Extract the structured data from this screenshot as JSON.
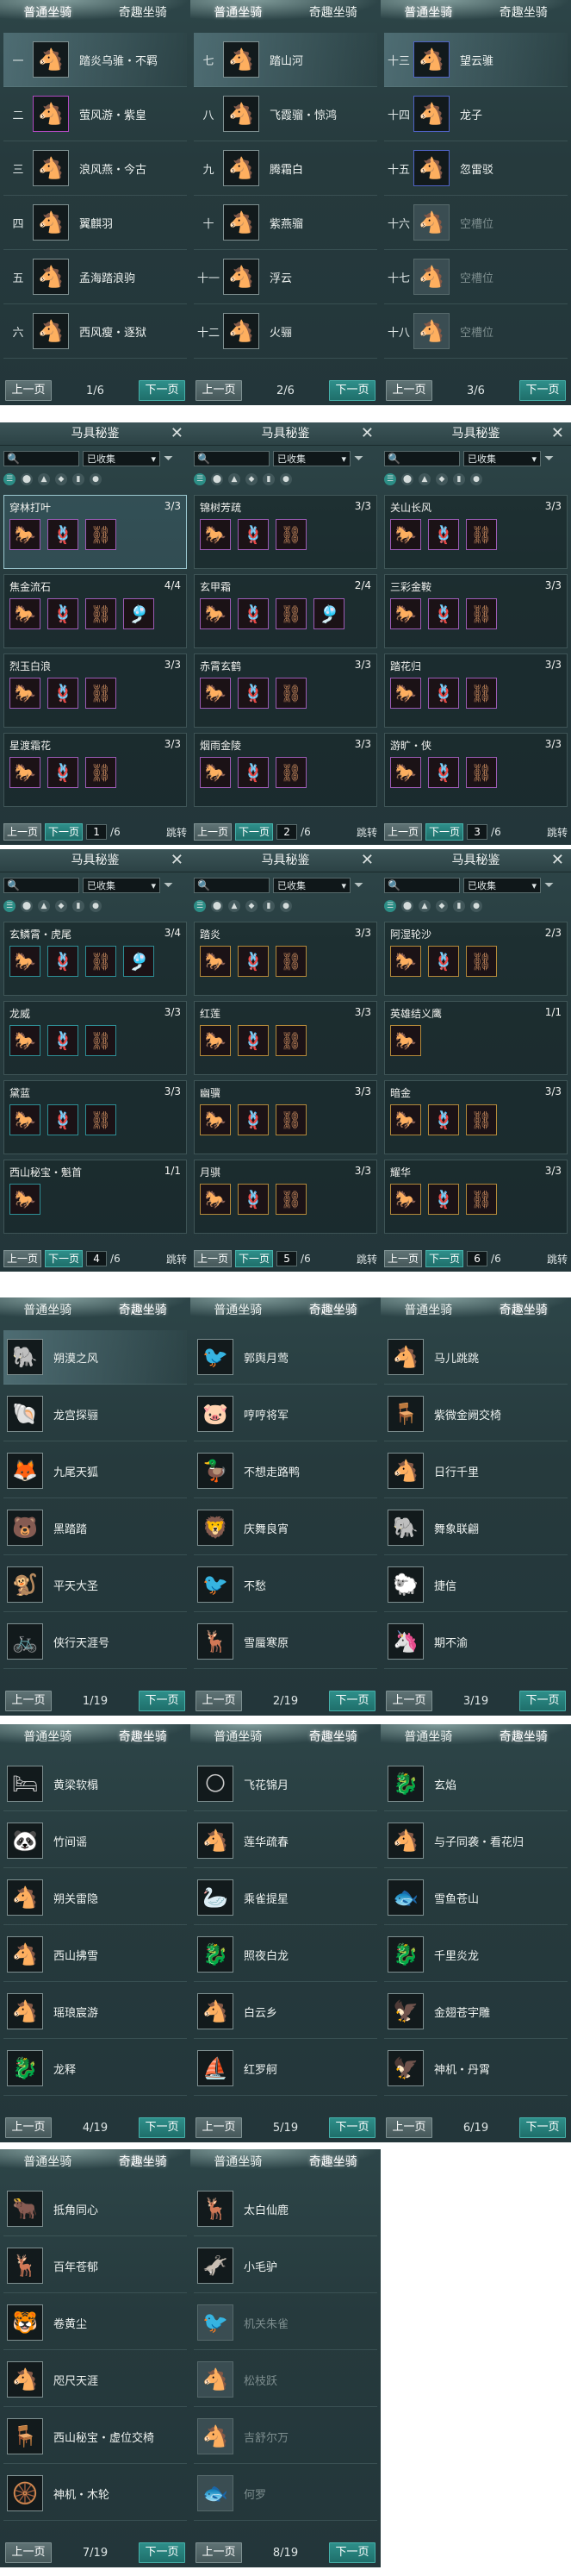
{
  "mount_tabs": {
    "normal": "普通坐骑",
    "fun": "奇趣坐骑"
  },
  "pager_labels": {
    "prev": "上一页",
    "next": "下一页"
  },
  "gear": {
    "title": "马具秘鉴",
    "close": "✕",
    "filter_value": "已收集",
    "jump": "跳转"
  },
  "mount_pages": [
    {
      "page": "1/6",
      "rows": [
        {
          "num": "一",
          "name": "踏炎乌骓・不羁",
          "icon": "🐴",
          "frame": "normal",
          "sel": true
        },
        {
          "num": "二",
          "name": "萤风游・紫皇",
          "icon": "🐴",
          "frame": "purple"
        },
        {
          "num": "三",
          "name": "浪风燕・今古",
          "icon": "🐴",
          "frame": "normal"
        },
        {
          "num": "四",
          "name": "翼麒羽",
          "icon": "🐴",
          "frame": "normal"
        },
        {
          "num": "五",
          "name": "孟海踏浪驹",
          "icon": "🐴",
          "frame": "normal"
        },
        {
          "num": "六",
          "name": "西风瘦・逐狱",
          "icon": "🐴",
          "frame": "normal"
        }
      ]
    },
    {
      "page": "2/6",
      "rows": [
        {
          "num": "七",
          "name": "踏山河",
          "icon": "🐴",
          "frame": "normal",
          "sel": true
        },
        {
          "num": "八",
          "name": "飞霞骝・惊鸿",
          "icon": "🐴",
          "frame": "normal"
        },
        {
          "num": "九",
          "name": "腾霜白",
          "icon": "🐴",
          "frame": "normal"
        },
        {
          "num": "十",
          "name": "紫燕骝",
          "icon": "🐴",
          "frame": "normal"
        },
        {
          "num": "十一",
          "name": "浮云",
          "icon": "🐴",
          "frame": "normal"
        },
        {
          "num": "十二",
          "name": "火骊",
          "icon": "🐴",
          "frame": "normal"
        }
      ]
    },
    {
      "page": "3/6",
      "rows": [
        {
          "num": "十三",
          "name": "望云骓",
          "icon": "🐴",
          "frame": "blue",
          "sel": true
        },
        {
          "num": "十四",
          "name": "龙子",
          "icon": "🐴",
          "frame": "blue"
        },
        {
          "num": "十五",
          "name": "忽雷驳",
          "icon": "🐴",
          "frame": "blue"
        },
        {
          "num": "十六",
          "name": "空槽位",
          "icon": "🐴",
          "frame": "empty"
        },
        {
          "num": "十七",
          "name": "空槽位",
          "icon": "🐴",
          "frame": "empty"
        },
        {
          "num": "十八",
          "name": "空槽位",
          "icon": "🐴",
          "frame": "empty"
        }
      ]
    }
  ],
  "gear_pages": [
    {
      "page": "1",
      "total": "/6",
      "sets": [
        {
          "name": "穿林打叶",
          "count": "3/3",
          "items": [
            "🐎",
            "🪢",
            "⛓"
          ],
          "sel": true
        },
        {
          "name": "焦金流石",
          "count": "4/4",
          "items": [
            "🐎",
            "🪢",
            "⛓",
            "🎐"
          ]
        },
        {
          "name": "烈玉白浪",
          "count": "3/3",
          "items": [
            "🐎",
            "🪢",
            "⛓"
          ]
        },
        {
          "name": "星渡霜花",
          "count": "3/3",
          "items": [
            "🐎",
            "🪢",
            "⛓"
          ]
        }
      ]
    },
    {
      "page": "2",
      "total": "/6",
      "sets": [
        {
          "name": "锦树芳疏",
          "count": "3/3",
          "items": [
            "🐎",
            "🪢",
            "⛓"
          ]
        },
        {
          "name": "玄甲霜",
          "count": "2/4",
          "items": [
            "🐎",
            "🪢",
            "⛓",
            "🎐"
          ]
        },
        {
          "name": "赤霄玄鹤",
          "count": "3/3",
          "items": [
            "🐎",
            "🪢",
            "⛓"
          ]
        },
        {
          "name": "烟雨金陵",
          "count": "3/3",
          "items": [
            "🐎",
            "🪢",
            "⛓"
          ]
        }
      ]
    },
    {
      "page": "3",
      "total": "/6",
      "sets": [
        {
          "name": "关山长风",
          "count": "3/3",
          "items": [
            "🐎",
            "🪢",
            "⛓"
          ]
        },
        {
          "name": "三彩金鞍",
          "count": "3/3",
          "items": [
            "🐎",
            "🪢",
            "⛓"
          ]
        },
        {
          "name": "踏花归",
          "count": "3/3",
          "items": [
            "🐎",
            "🪢",
            "⛓"
          ]
        },
        {
          "name": "游旷・侠",
          "count": "3/3",
          "items": [
            "🐎",
            "🪢",
            "⛓"
          ]
        }
      ]
    },
    {
      "page": "4",
      "total": "/6",
      "sets": [
        {
          "name": "玄鳞霄・虎尾",
          "count": "3/4",
          "items": [
            "🐎",
            "🪢",
            "⛓",
            "🎐"
          ]
        },
        {
          "name": "龙威",
          "count": "3/3",
          "items": [
            "🐎",
            "🪢",
            "⛓"
          ]
        },
        {
          "name": "黛蓝",
          "count": "3/3",
          "items": [
            "🐎",
            "🪢",
            "⛓"
          ]
        },
        {
          "name": "西山秘宝・魁首",
          "count": "1/1",
          "items": [
            "🐎"
          ]
        }
      ]
    },
    {
      "page": "5",
      "total": "/6",
      "sets": [
        {
          "name": "踏炎",
          "count": "3/3",
          "items": [
            "🐎",
            "🪢",
            "⛓"
          ]
        },
        {
          "name": "红莲",
          "count": "3/3",
          "items": [
            "🐎",
            "🪢",
            "⛓"
          ]
        },
        {
          "name": "幽骥",
          "count": "3/3",
          "items": [
            "🐎",
            "🪢",
            "⛓"
          ]
        },
        {
          "name": "月骐",
          "count": "3/3",
          "items": [
            "🐎",
            "🪢",
            "⛓"
          ]
        }
      ]
    },
    {
      "page": "6",
      "total": "/6",
      "sets": [
        {
          "name": "阿湿轮沙",
          "count": "2/3",
          "items": [
            "🐎",
            "🪢",
            "⛓"
          ]
        },
        {
          "name": "英雄结义鹰",
          "count": "1/1",
          "items": [
            "🐎"
          ]
        },
        {
          "name": "暗金",
          "count": "3/3",
          "items": [
            "🐎",
            "🪢",
            "⛓"
          ]
        },
        {
          "name": "耀华",
          "count": "3/3",
          "items": [
            "🐎",
            "🪢",
            "⛓"
          ]
        }
      ]
    }
  ],
  "fun_pages": [
    {
      "page": "1/19",
      "rows": [
        {
          "name": "朔漠之风",
          "icon": "🐘",
          "sel": true
        },
        {
          "name": "龙宫探骊",
          "icon": "🐚"
        },
        {
          "name": "九尾天狐",
          "icon": "🦊"
        },
        {
          "name": "黑踏踏",
          "icon": "🐻"
        },
        {
          "name": "平天大圣",
          "icon": "🐒"
        },
        {
          "name": "侠行天涯号",
          "icon": "🚲"
        }
      ]
    },
    {
      "page": "2/19",
      "rows": [
        {
          "name": "郭舆月莺",
          "icon": "🐦"
        },
        {
          "name": "哼哼将军",
          "icon": "🐷"
        },
        {
          "name": "不想走路鸭",
          "icon": "🦆"
        },
        {
          "name": "庆舞良宵",
          "icon": "🦁"
        },
        {
          "name": "不愁",
          "icon": "🐦"
        },
        {
          "name": "雪蜃寒原",
          "icon": "🦌"
        }
      ]
    },
    {
      "page": "3/19",
      "rows": [
        {
          "name": "马儿跳跳",
          "icon": "🐴"
        },
        {
          "name": "紫微金阙交椅",
          "icon": "🪑"
        },
        {
          "name": "日行千里",
          "icon": "🐴"
        },
        {
          "name": "舞象联翩",
          "icon": "🐘"
        },
        {
          "name": "捷信",
          "icon": "🐑"
        },
        {
          "name": "期不渝",
          "icon": "🦄"
        }
      ]
    },
    {
      "page": "4/19",
      "rows": [
        {
          "name": "黄梁软榻",
          "icon": "🛏"
        },
        {
          "name": "竹间谣",
          "icon": "🐼"
        },
        {
          "name": "朔关雷隐",
          "icon": "🐴"
        },
        {
          "name": "西山拂雪",
          "icon": "🐴"
        },
        {
          "name": "瑶琅宸游",
          "icon": "🐴"
        },
        {
          "name": "龙释",
          "icon": "🐉"
        }
      ]
    },
    {
      "page": "5/19",
      "rows": [
        {
          "name": "飞花锦月",
          "icon": "🌕"
        },
        {
          "name": "莲华疏春",
          "icon": "🐴"
        },
        {
          "name": "乘雀提星",
          "icon": "🦢"
        },
        {
          "name": "照夜白龙",
          "icon": "🐉"
        },
        {
          "name": "白云乡",
          "icon": "🐴"
        },
        {
          "name": "红罗舸",
          "icon": "⛵"
        }
      ]
    },
    {
      "page": "6/19",
      "rows": [
        {
          "name": "玄焰",
          "icon": "🐉"
        },
        {
          "name": "与子同袭・看花归",
          "icon": "🐴"
        },
        {
          "name": "雪鱼苍山",
          "icon": "🐟"
        },
        {
          "name": "千里炎龙",
          "icon": "🐉"
        },
        {
          "name": "金翅苍宇雕",
          "icon": "🦅"
        },
        {
          "name": "神机・丹霄",
          "icon": "🦅"
        }
      ]
    },
    {
      "page": "7/19",
      "rows": [
        {
          "name": "抵角同心",
          "icon": "🐂"
        },
        {
          "name": "百年苍郁",
          "icon": "🦌"
        },
        {
          "name": "卷黄尘",
          "icon": "🐯"
        },
        {
          "name": "咫尺天涯",
          "icon": "🐴"
        },
        {
          "name": "西山秘宝・虚位交椅",
          "icon": "🪑"
        },
        {
          "name": "神机・木轮",
          "icon": "🛞"
        }
      ]
    },
    {
      "page": "8/19",
      "rows": [
        {
          "name": "太白仙鹿",
          "icon": "🦌"
        },
        {
          "name": "小毛驴",
          "icon": "🫏"
        },
        {
          "name": "机关朱雀",
          "icon": "🐦",
          "dim": true
        },
        {
          "name": "松枝跃",
          "icon": "🐴",
          "dim": true
        },
        {
          "name": "吉舒尔万",
          "icon": "🐴",
          "dim": true
        },
        {
          "name": "何罗",
          "icon": "🐟",
          "dim": true
        }
      ]
    }
  ],
  "colors": {
    "panel": "#263a3d",
    "accent": "#2e8f8a",
    "purple_frame": "#9c5bb5",
    "blue_frame": "#4f62c4"
  }
}
